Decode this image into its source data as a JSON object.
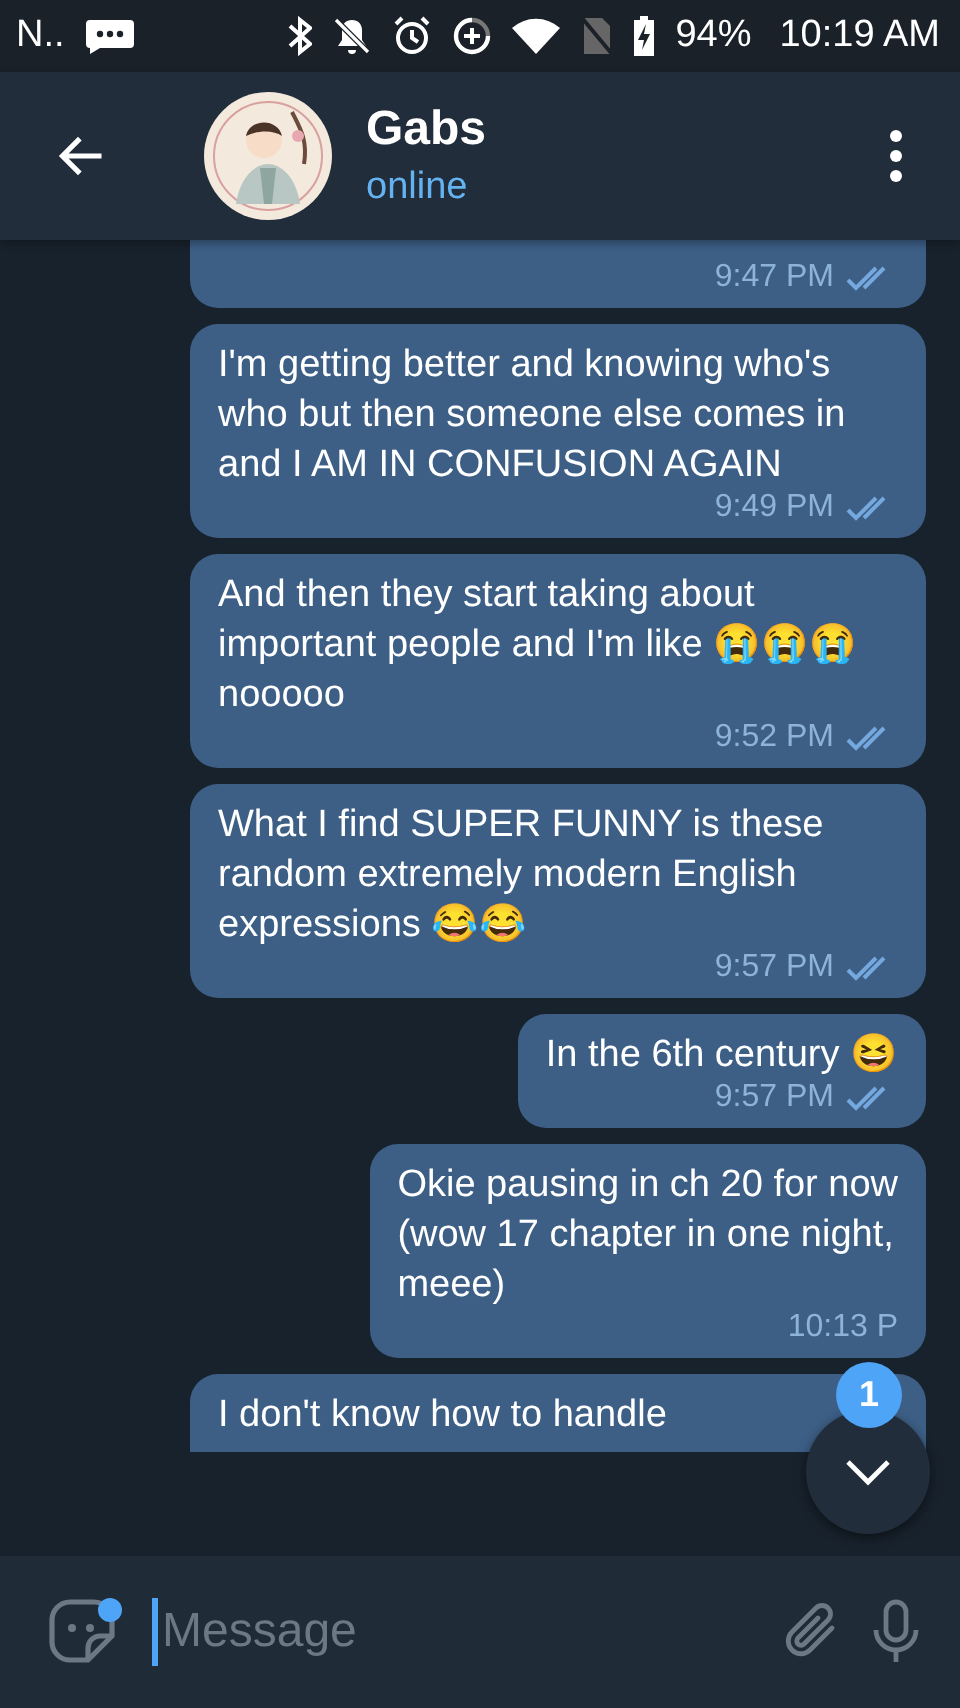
{
  "status_bar": {
    "carrier": "N..",
    "battery": "94%",
    "time": "10:19 AM"
  },
  "header": {
    "name": "Gabs",
    "status": "online"
  },
  "messages": [
    {
      "time": "9:47 PM",
      "read": true
    },
    {
      "text": "I'm getting better and knowing who's who but then someone else comes in and I AM IN CONFUSION AGAIN",
      "time": "9:49 PM",
      "read": true
    },
    {
      "text": "And then they start taking about important people and I'm like 😭😭😭 nooooo",
      "time": "9:52 PM",
      "read": true
    },
    {
      "text": "What I find SUPER FUNNY is these random extremely modern English expressions 😂😂",
      "time": "9:57 PM",
      "read": true
    },
    {
      "text": "In the 6th century 😆",
      "time": "9:57 PM",
      "read": true
    },
    {
      "text": "Okie pausing in ch 20 for now\n(wow 17 chapter in one night,\nmeee)",
      "time": "10:13 P"
    },
    {
      "text": "I don't know how to handle"
    }
  ],
  "scroll_button": {
    "badge": "1"
  },
  "composer": {
    "placeholder": "Message"
  }
}
